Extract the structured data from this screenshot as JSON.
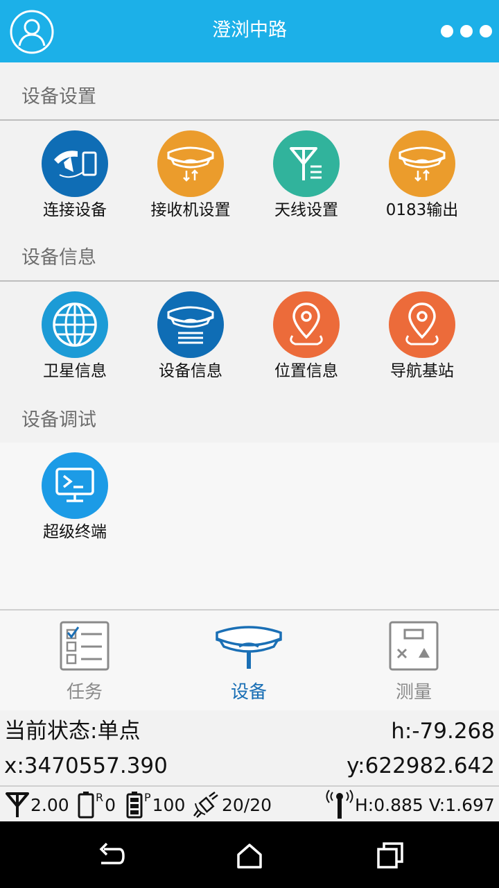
{
  "header": {
    "title": "澄浏中路"
  },
  "sections": [
    {
      "label": "设备设置",
      "items": [
        {
          "label": "连接设备",
          "icon": "connect-device-icon",
          "color": "#0f6db5"
        },
        {
          "label": "接收机设置",
          "icon": "receiver-settings-icon",
          "color": "#eb9c2c"
        },
        {
          "label": "天线设置",
          "icon": "antenna-settings-icon",
          "color": "#31b39c"
        },
        {
          "label": "0183输出",
          "icon": "nmea-output-icon",
          "color": "#eb9c2c"
        }
      ]
    },
    {
      "label": "设备信息",
      "items": [
        {
          "label": "卫星信息",
          "icon": "globe-icon",
          "color": "#1c9bd6"
        },
        {
          "label": "设备信息",
          "icon": "device-info-icon",
          "color": "#0f6db5"
        },
        {
          "label": "位置信息",
          "icon": "location-pin-icon",
          "color": "#ec6b3a"
        },
        {
          "label": "导航基站",
          "icon": "navigation-pin-icon",
          "color": "#ec6b3a"
        }
      ]
    },
    {
      "label": "设备调试",
      "items": [
        {
          "label": "超级终端",
          "icon": "terminal-icon",
          "color": "#1c9be6"
        }
      ]
    }
  ],
  "bottom_nav": [
    {
      "label": "任务",
      "icon": "task-checklist-icon",
      "active": false
    },
    {
      "label": "设备",
      "icon": "gnss-receiver-icon",
      "active": true
    },
    {
      "label": "测量",
      "icon": "survey-calculator-icon",
      "active": false
    }
  ],
  "status": {
    "state_label": "当前状态:",
    "state_value": "单点",
    "h": "h:-79.268",
    "x_label": "x:",
    "x_value": "3470557.390",
    "y_label": "y:",
    "y_value": "622982.642",
    "antenna": "2.00",
    "r_label": "R",
    "r_value": "0",
    "p_label": "P",
    "p_value": "100",
    "satellites": "20/20",
    "precision": "H:0.885 V:1.697"
  },
  "colors": {
    "header": "#1cb0e8",
    "active_nav": "#1a6fb5"
  }
}
